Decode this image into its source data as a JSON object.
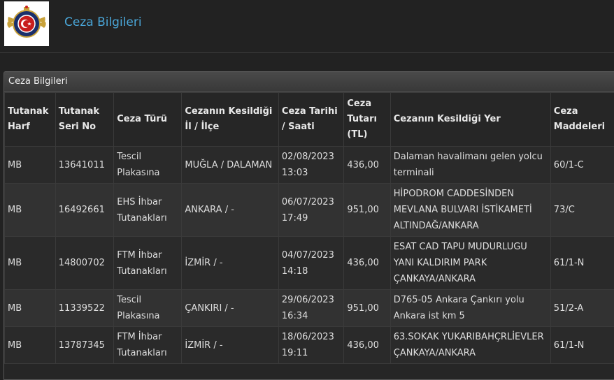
{
  "header": {
    "title": "Ceza Bilgileri"
  },
  "panel": {
    "title": "Ceza Bilgileri"
  },
  "table": {
    "columns": [
      "Tutanak Harf",
      "Tutanak Seri No",
      "Ceza Türü",
      "Cezanın Kesildiği İl / İlçe",
      "Ceza Tarihi / Saati",
      "Ceza Tutarı (TL)",
      "Cezanın Kesildiği Yer",
      "Ceza Maddeleri"
    ],
    "rows": [
      [
        "MB",
        "13641011",
        "Tescil Plakasına",
        "MUĞLA / DALAMAN",
        "02/08/2023 13:03",
        "436,00",
        "Dalaman havalimanı gelen yolcu terminali",
        "60/1-C"
      ],
      [
        "MB",
        "16492661",
        "EHS İhbar Tutanakları",
        "ANKARA / -",
        "06/07/2023 17:49",
        "951,00",
        "HİPODROM CADDESİNDEN MEVLANA BULVARI İSTİKAMETİ ALTINDAĞ/ANKARA",
        "73/C"
      ],
      [
        "MB",
        "14800702",
        "FTM İhbar Tutanakları",
        "İZMİR / -",
        "04/07/2023 14:18",
        "436,00",
        "ESAT CAD TAPU MUDURLUGU YANI KALDIRIM PARK ÇANKAYA/ANKARA",
        "61/1-N"
      ],
      [
        "MB",
        "11339522",
        "Tescil Plakasına",
        "ÇANKIRI / -",
        "29/06/2023 16:34",
        "951,00",
        "D765-05 Ankara Çankırı yolu Ankara ist km 5",
        "51/2-A"
      ],
      [
        "MB",
        "13787345",
        "FTM İhbar Tutanakları",
        "İZMİR / -",
        "18/06/2023 19:11",
        "436,00",
        "63.SOKAK YUKARIBAHÇRLİEVLER ÇANKAYA/ANKARA",
        "61/1-N"
      ]
    ]
  },
  "colors": {
    "title_accent": "#4aa6d8",
    "background": "#222222"
  },
  "icons": {
    "logo": "police-badge-icon"
  }
}
